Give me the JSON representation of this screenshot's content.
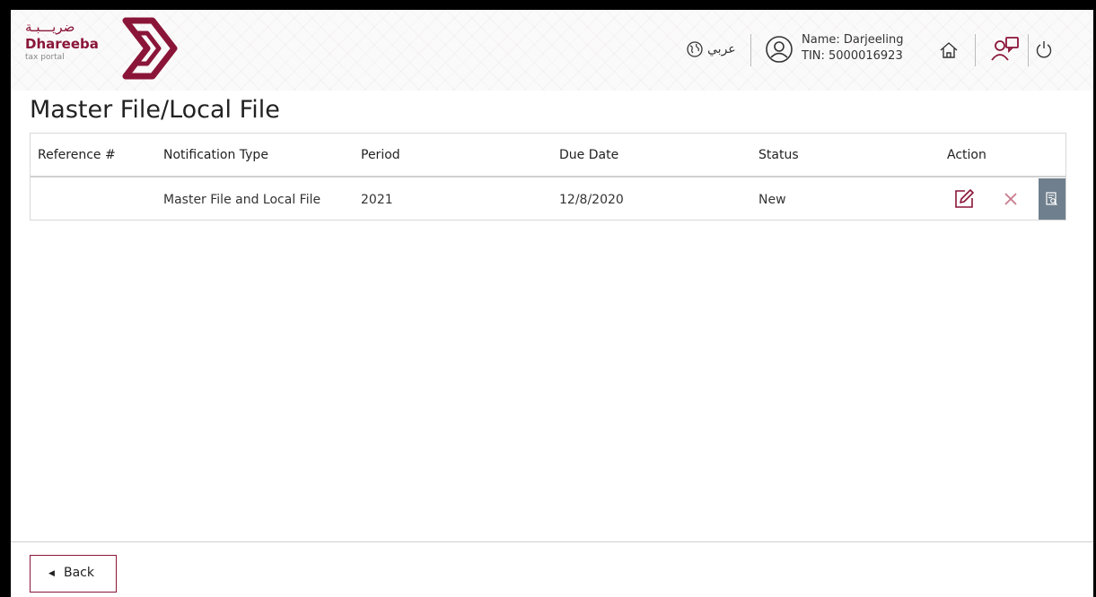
{
  "brand": {
    "arabic_name": "ضريـــبـة",
    "english_name": "Dhareeba",
    "tagline": "tax portal",
    "color": "#8a1538"
  },
  "header": {
    "language_label": "عربي",
    "user_name": "Name: Darjeeling",
    "user_tin": "TIN: 5000016923",
    "icons": [
      "globe-icon",
      "user-icon",
      "home-icon",
      "people-icon",
      "power-icon"
    ]
  },
  "page": {
    "title": "Master File/Local File"
  },
  "table": {
    "columns": [
      "Reference #",
      "Notification Type",
      "Period",
      "Due Date",
      "Status",
      "Action"
    ],
    "rows": [
      {
        "reference": "",
        "notification_type": "Master File and Local File",
        "period": "2021",
        "due_date": "12/8/2020",
        "status": "New",
        "actions": [
          "edit-icon",
          "delete-icon",
          "view-icon"
        ]
      }
    ]
  },
  "footer": {
    "back_label": "Back"
  },
  "colors": {
    "accent": "#8a1538",
    "delete": "#c77a8b",
    "view_button_bg": "#6f7f8d"
  }
}
